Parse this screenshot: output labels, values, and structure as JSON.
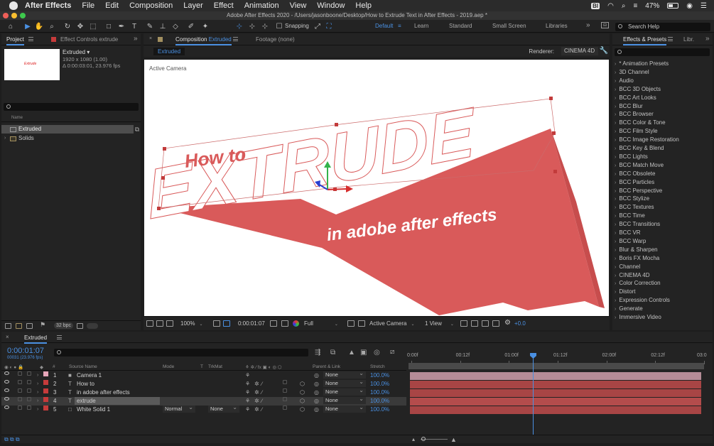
{
  "menubar": {
    "app": "After Effects",
    "items": [
      "File",
      "Edit",
      "Composition",
      "Layer",
      "Effect",
      "Animation",
      "View",
      "Window",
      "Help"
    ],
    "battery": "47%"
  },
  "window": {
    "title": "Adobe After Effects 2020 - /Users/jasonboone/Desktop/How to Extrude Text in After Effects - 2019.aep *"
  },
  "toolbar": {
    "snapping": "Snapping",
    "workspaces": [
      "Default",
      "Learn",
      "Standard",
      "Small Screen",
      "Libraries"
    ],
    "search_placeholder": "Search Help"
  },
  "project": {
    "tab_project": "Project",
    "tab_effect_controls": "Effect Controls extrude",
    "thumb_text": "Extrude",
    "item_name": "Extruded ▾",
    "item_size": "1920 x 1080 (1.00)",
    "item_duration": "Δ 0:00:03:01, 23.976 fps",
    "column_name": "Name",
    "rows": [
      {
        "label": "Extruded",
        "type": "comp"
      },
      {
        "label": "Solids",
        "type": "folder"
      }
    ],
    "bpc": "32 bpc"
  },
  "composition": {
    "tab_label": "Composition",
    "tab_name": "Extruded",
    "footage_tab": "Footage (none)",
    "chip": "Extruded",
    "renderer_label": "Renderer:",
    "renderer_value": "CINEMA 4D",
    "active_camera": "Active Camera",
    "art": {
      "line1": "How to",
      "line2": "EXTRUDE",
      "line3": "in adobe after effects",
      "color": "#d95a5a"
    },
    "footer": {
      "zoom": "100%",
      "time": "0:00:01:07",
      "resolution": "Full",
      "camera": "Active Camera",
      "views": "1 View",
      "exposure": "+0.0"
    }
  },
  "effects": {
    "tab": "Effects & Presets",
    "tab2": "Libr.",
    "items": [
      "* Animation Presets",
      "3D Channel",
      "Audio",
      "BCC 3D Objects",
      "BCC Art Looks",
      "BCC Blur",
      "BCC Browser",
      "BCC Color & Tone",
      "BCC Film Style",
      "BCC Image Restoration",
      "BCC Key & Blend",
      "BCC Lights",
      "BCC Match Move",
      "BCC Obsolete",
      "BCC Particles",
      "BCC Perspective",
      "BCC Stylize",
      "BCC Textures",
      "BCC Time",
      "BCC Transitions",
      "BCC VR",
      "BCC Warp",
      "Blur & Sharpen",
      "Boris FX Mocha",
      "Channel",
      "CINEMA 4D",
      "Color Correction",
      "Distort",
      "Expression Controls",
      "Generate",
      "Immersive Video"
    ]
  },
  "timeline": {
    "tab": "Extruded",
    "time": "0:00:01:07",
    "fps": "00031 (23.976 fps)",
    "columns": {
      "num": "#",
      "source": "Source Name",
      "mode": "Mode",
      "t": "T",
      "trkmat": "TrkMat",
      "parent": "Parent & Link",
      "stretch": "Stretch"
    },
    "ruler": [
      "0:00f",
      "00:12f",
      "01:00f",
      "01:12f",
      "02:00f",
      "02:12f",
      "03:0"
    ],
    "playhead_fraction": 0.42,
    "layers": [
      {
        "num": "1",
        "name": "Camera 1",
        "type": "camera",
        "label_color": "#e6a6b9",
        "parent": "None",
        "stretch": "100.0%",
        "mode": "",
        "trkmat": ""
      },
      {
        "num": "2",
        "name": "How to",
        "type": "text",
        "label_color": "#c63b3b",
        "parent": "None",
        "stretch": "100.0%",
        "mode": "",
        "trkmat": ""
      },
      {
        "num": "3",
        "name": "in adobe after effects",
        "type": "text",
        "label_color": "#c63b3b",
        "parent": "None",
        "stretch": "100.0%",
        "mode": "",
        "trkmat": ""
      },
      {
        "num": "4",
        "name": "extrude",
        "type": "text",
        "label_color": "#c63b3b",
        "parent": "None",
        "stretch": "100.0%",
        "mode": "",
        "trkmat": ""
      },
      {
        "num": "5",
        "name": "White Solid 1",
        "type": "solid",
        "label_color": "#c63b3b",
        "parent": "None",
        "stretch": "100.0%",
        "mode": "Normal",
        "trkmat": "None"
      }
    ]
  }
}
